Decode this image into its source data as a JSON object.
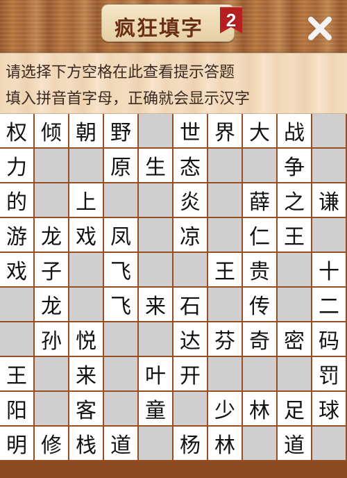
{
  "header": {
    "title": "疯狂填字",
    "level_badge": "2",
    "close_icon": "close-icon"
  },
  "hints": {
    "line1": "请选择下方空格在此查看提示答题",
    "line2": "填入拼音首字母，正确就会显示汉字"
  },
  "grid": {
    "rows": 10,
    "cols": 10,
    "cells": [
      [
        "权",
        "倾",
        "朝",
        "野",
        "",
        "世",
        "界",
        "大",
        "战",
        ""
      ],
      [
        "力",
        "",
        "",
        "原",
        "生",
        "态",
        "",
        "",
        "争",
        ""
      ],
      [
        "的",
        "",
        "上",
        "",
        "",
        "炎",
        "",
        "薛",
        "之",
        "谦"
      ],
      [
        "游",
        "龙",
        "戏",
        "凤",
        "",
        "凉",
        "",
        "仁",
        "王",
        ""
      ],
      [
        "戏",
        "子",
        "",
        "飞",
        "",
        "",
        "王",
        "贵",
        "",
        "十"
      ],
      [
        "",
        "龙",
        "",
        "飞",
        "来",
        "石",
        "",
        "传",
        "",
        "二"
      ],
      [
        "",
        "孙",
        "悦",
        "",
        "",
        "达",
        "芬",
        "奇",
        "密",
        "码"
      ],
      [
        "王",
        "",
        "来",
        "",
        "叶",
        "开",
        "",
        "",
        "",
        "罚"
      ],
      [
        "阳",
        "",
        "客",
        "",
        "童",
        "",
        "少",
        "林",
        "足",
        "球"
      ],
      [
        "明",
        "修",
        "栈",
        "道",
        "",
        "杨",
        "林",
        "",
        "道",
        ""
      ]
    ]
  }
}
